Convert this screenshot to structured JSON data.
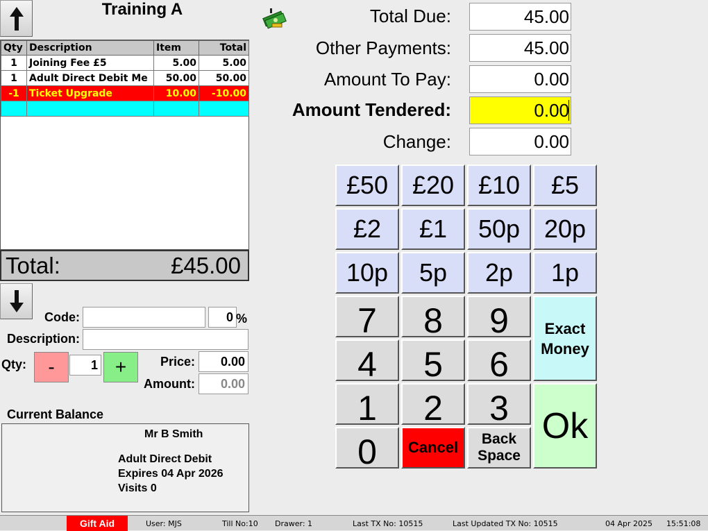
{
  "header": {
    "title": "Training A"
  },
  "basket": {
    "columns": [
      "Qty",
      "Description",
      "Item",
      "Total"
    ],
    "rows": [
      {
        "qty": "1",
        "description": "Joining Fee £5",
        "item": "5.00",
        "total": "5.00"
      },
      {
        "qty": "1",
        "description": "Adult Direct Debit Me",
        "item": "50.00",
        "total": "50.00"
      },
      {
        "qty": "-1",
        "description": "Ticket Upgrade",
        "item": "10.00",
        "total": "-10.00"
      }
    ],
    "total_label": "Total:",
    "total_value": "£45.00"
  },
  "entry": {
    "code_label": "Code:",
    "code_value": "",
    "percent_value": "0",
    "percent_sign": "%",
    "description_label": "Description:",
    "description_value": "",
    "qty_label": "Qty:",
    "minus_label": "-",
    "qty_value": "1",
    "plus_label": "+",
    "price_label": "Price:",
    "price_value": "0.00",
    "amount_label": "Amount:",
    "amount_value": "0.00"
  },
  "balance": {
    "heading": "Current Balance",
    "name": "Mr B Smith",
    "line1": "Adult Direct Debit",
    "line2": "Expires 04 Apr 2026",
    "line3": "Visits 0"
  },
  "payment": {
    "total_due_label": "Total Due:",
    "total_due": "45.00",
    "other_label": "Other Payments:",
    "other": "45.00",
    "to_pay_label": "Amount To Pay:",
    "to_pay": "0.00",
    "tendered_label": "Amount Tendered:",
    "tendered": "0.00",
    "change_label": "Change:",
    "change": "0.00"
  },
  "keypad": {
    "coins": [
      "£50",
      "£20",
      "£10",
      "£5",
      "£2",
      "£1",
      "50p",
      "20p",
      "10p",
      "5p",
      "2p",
      "1p"
    ],
    "digits": [
      "7",
      "8",
      "9",
      "4",
      "5",
      "6",
      "1",
      "2",
      "3",
      "0"
    ],
    "exact_line1": "Exact",
    "exact_line2": "Money",
    "ok": "Ok",
    "cancel": "Cancel",
    "back_line1": "Back",
    "back_line2": "Space"
  },
  "status": {
    "gift_aid": "Gift Aid",
    "user": "User: MJS",
    "till": "Till No:10",
    "drawer": "Drawer: 1",
    "last_tx": "Last TX No: 10515",
    "last_updated": "Last Updated TX No: 10515",
    "date": "04 Apr 2025",
    "time": "15:51:08"
  },
  "colors": {
    "selected_row": "#ff0000",
    "selected_text": "#ffff00",
    "blank_row": "#00ffff",
    "tendered_bg": "#ffff00",
    "coin_key": "#d8ddf8",
    "cancel_key": "#ff0000",
    "exact_key": "#c8f8f8",
    "ok_key": "#ccffcc",
    "minus_btn": "#ff9999",
    "plus_btn": "#88ee88"
  },
  "icons": {
    "scroll_up": "arrow-up-icon",
    "scroll_down": "arrow-down-icon",
    "cash": "cash-icon"
  }
}
